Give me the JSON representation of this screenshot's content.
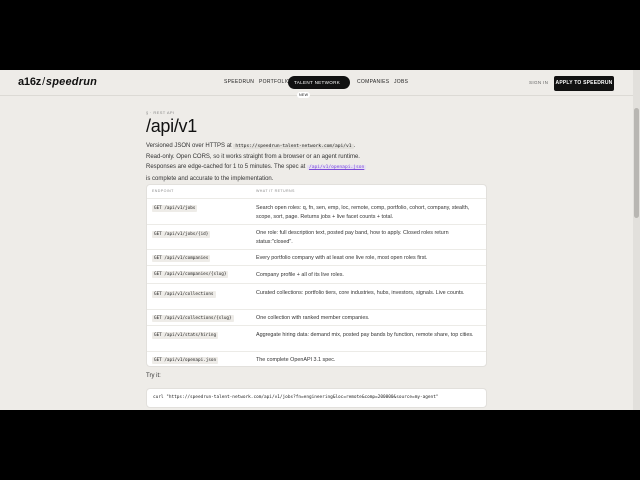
{
  "nav": {
    "logo_prefix": "a16z",
    "logo_brand": "speedrun",
    "links": [
      "SPEEDRUN",
      "PORTFOLIO",
      "COMPANIES",
      "JOBS"
    ],
    "talent_network": "TALENT NETWORK",
    "talent_badge": "NEW",
    "sign_in": "SIGN IN",
    "apply": "APPLY TO SPEEDRUN"
  },
  "page": {
    "eyebrow": "§ · REST API",
    "title": "/api/v1",
    "intro_1": "Versioned JSON over HTTPS at ",
    "base_url": "https://speedrun-talent-network.com/api/v1",
    "intro_1_end": ".",
    "intro_2": "Read-only. Open CORS, so it works straight from a browser or an agent runtime.",
    "intro_3": "Responses are edge-cached for 1 to 5 minutes. The spec at ",
    "spec_link": "/api/v1/openapi.json",
    "intro_4": "is complete and accurate to the implementation."
  },
  "table": {
    "col_endpoint": "ENDPOINT",
    "col_returns": "WHAT IT RETURNS",
    "rows": [
      {
        "endpoint": "GET /api/v1/jobs",
        "desc": "Search open roles: q, fn, sen, emp, loc, remote, comp, portfolio, cohort, company, stealth, scope, sort, page. Returns jobs + live facet counts + total."
      },
      {
        "endpoint": "GET /api/v1/jobs/{id}",
        "desc": "One role: full description text, posted pay band, how to apply. Closed roles return status:\"closed\"."
      },
      {
        "endpoint": "GET /api/v1/companies",
        "desc": "Every portfolio company with at least one live role, most open roles first."
      },
      {
        "endpoint": "GET /api/v1/companies/{slug}",
        "desc": "Company profile + all of its live roles."
      },
      {
        "endpoint": "GET /api/v1/collections",
        "desc": "Curated collections: portfolio tiers, core industries, hubs, investors, signals. Live counts."
      },
      {
        "endpoint": "GET /api/v1/collections/{slug}",
        "desc": "One collection with ranked member companies."
      },
      {
        "endpoint": "GET /api/v1/stats/hiring",
        "desc": "Aggregate hiring data: demand mix, posted pay bands by function, remote share, top cities."
      },
      {
        "endpoint": "GET /api/v1/openapi.json",
        "desc": "The complete OpenAPI 3.1 spec."
      }
    ]
  },
  "try_it": {
    "label": "Try it:",
    "command": "curl \"https://speedrun-talent-network.com/api/v1/jobs?fn=engineering&loc=remote&comp=200000&source=my-agent\""
  }
}
